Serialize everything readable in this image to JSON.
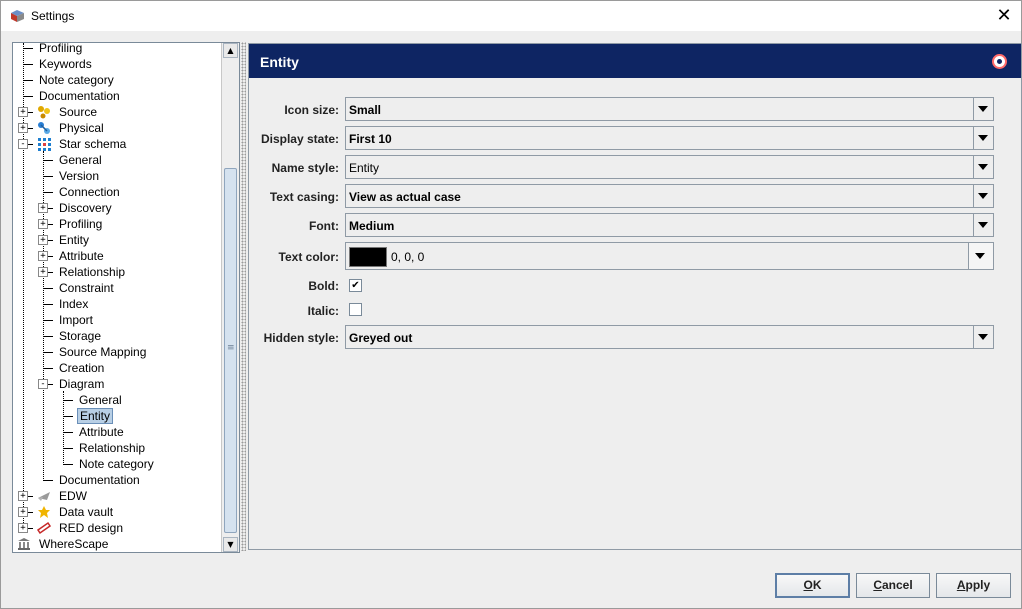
{
  "window": {
    "title": "Settings"
  },
  "tree": {
    "items": [
      {
        "label": "Profiling",
        "level": 1,
        "expander": ""
      },
      {
        "label": "Keywords",
        "level": 1,
        "expander": ""
      },
      {
        "label": "Note category",
        "level": 1,
        "expander": ""
      },
      {
        "label": "Documentation",
        "level": 1,
        "expander": ""
      },
      {
        "label": "Source",
        "level": 1,
        "expander": "+",
        "icon": "source-icon"
      },
      {
        "label": "Physical",
        "level": 1,
        "expander": "+",
        "icon": "physical-icon"
      },
      {
        "label": "Star schema",
        "level": 1,
        "expander": "-",
        "icon": "star-schema-icon"
      },
      {
        "label": "General",
        "level": 2,
        "expander": ""
      },
      {
        "label": "Version",
        "level": 2,
        "expander": ""
      },
      {
        "label": "Connection",
        "level": 2,
        "expander": ""
      },
      {
        "label": "Discovery",
        "level": 2,
        "expander": "+"
      },
      {
        "label": "Profiling",
        "level": 2,
        "expander": "+"
      },
      {
        "label": "Entity",
        "level": 2,
        "expander": "+"
      },
      {
        "label": "Attribute",
        "level": 2,
        "expander": "+"
      },
      {
        "label": "Relationship",
        "level": 2,
        "expander": "+"
      },
      {
        "label": "Constraint",
        "level": 2,
        "expander": ""
      },
      {
        "label": "Index",
        "level": 2,
        "expander": ""
      },
      {
        "label": "Import",
        "level": 2,
        "expander": ""
      },
      {
        "label": "Storage",
        "level": 2,
        "expander": ""
      },
      {
        "label": "Source Mapping",
        "level": 2,
        "expander": ""
      },
      {
        "label": "Creation",
        "level": 2,
        "expander": ""
      },
      {
        "label": "Diagram",
        "level": 2,
        "expander": "-"
      },
      {
        "label": "General",
        "level": 3,
        "expander": ""
      },
      {
        "label": "Entity",
        "level": 3,
        "expander": "",
        "selected": true
      },
      {
        "label": "Attribute",
        "level": 3,
        "expander": ""
      },
      {
        "label": "Relationship",
        "level": 3,
        "expander": ""
      },
      {
        "label": "Note category",
        "level": 3,
        "expander": ""
      },
      {
        "label": "Documentation",
        "level": 2,
        "expander": ""
      },
      {
        "label": "EDW",
        "level": 1,
        "expander": "+",
        "icon": "edw-icon"
      },
      {
        "label": "Data vault",
        "level": 1,
        "expander": "+",
        "icon": "data-vault-icon"
      },
      {
        "label": "RED design",
        "level": 1,
        "expander": "+",
        "icon": "red-design-icon"
      },
      {
        "label": "WhereScape",
        "level": 0,
        "expander": "",
        "icon": "wherescape-icon"
      }
    ]
  },
  "panel": {
    "title": "Entity",
    "fields": {
      "icon_size": {
        "label": "Icon size:",
        "value": "Small"
      },
      "display_state": {
        "label": "Display state:",
        "value": "First 10"
      },
      "name_style": {
        "label": "Name style:",
        "value": "Entity"
      },
      "text_casing": {
        "label": "Text casing:",
        "value": "View as actual case"
      },
      "font": {
        "label": "Font:",
        "value": "Medium"
      },
      "text_color": {
        "label": "Text color:",
        "value": "0, 0, 0",
        "swatch": "#000000"
      },
      "bold": {
        "label": "Bold:",
        "checked": true
      },
      "italic": {
        "label": "Italic:",
        "checked": false
      },
      "hidden_style": {
        "label": "Hidden style:",
        "value": "Greyed out"
      }
    }
  },
  "buttons": {
    "ok": {
      "mnemonic": "O",
      "rest": "K"
    },
    "cancel": {
      "mnemonic": "C",
      "rest": "ancel"
    },
    "apply": {
      "mnemonic": "A",
      "rest": "pply"
    }
  },
  "colors": {
    "header_bg": "#0e2563",
    "selection_bg": "#b8cfe5"
  }
}
